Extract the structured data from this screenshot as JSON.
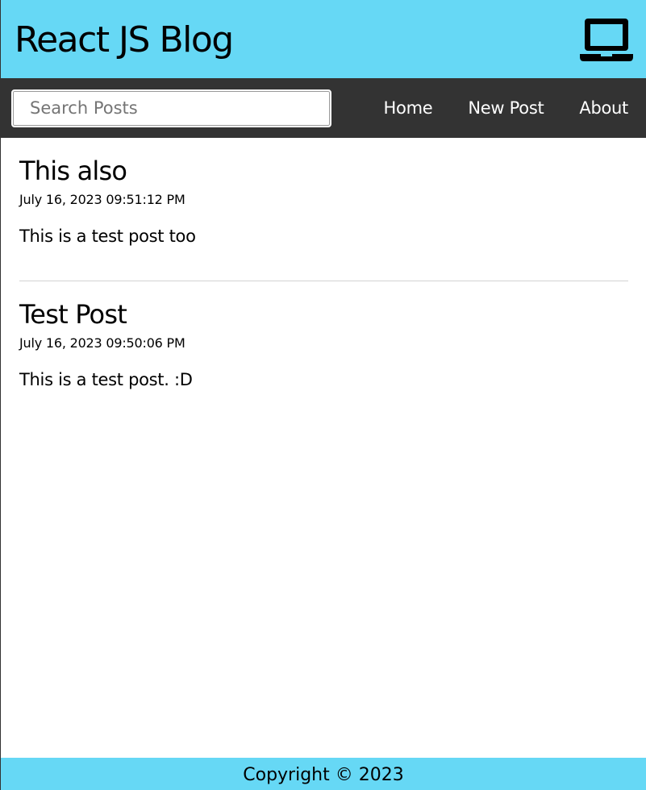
{
  "header": {
    "title": "React JS Blog",
    "icon": "laptop-icon",
    "background": "#66d8f5"
  },
  "nav": {
    "background": "#333333",
    "search": {
      "placeholder": "Search Posts",
      "value": ""
    },
    "links": [
      {
        "label": "Home"
      },
      {
        "label": "New Post"
      },
      {
        "label": "About"
      }
    ]
  },
  "posts": [
    {
      "title": "This also",
      "datetime": "July 16, 2023 09:51:12 PM",
      "body": "This is a test post too"
    },
    {
      "title": "Test Post",
      "datetime": "July 16, 2023 09:50:06 PM",
      "body": "This is a test post. :D"
    }
  ],
  "footer": {
    "copyright": "Copyright © 2023"
  }
}
